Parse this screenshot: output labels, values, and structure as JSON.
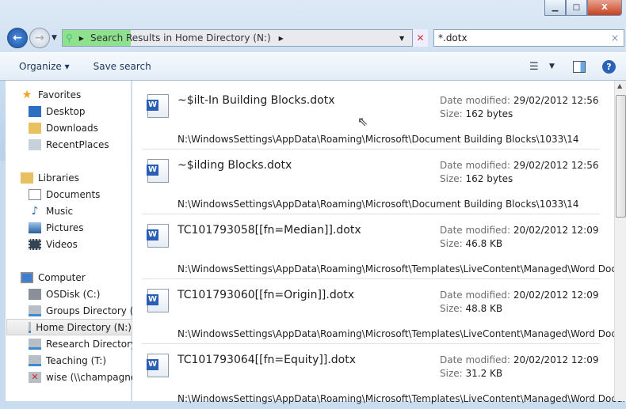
{
  "window": {
    "minimize": "▁",
    "maximize": "□",
    "close": "X"
  },
  "nav": {
    "address_root": "Search Results in Home Directory (N:)",
    "search_value": "*.dotx"
  },
  "toolbar": {
    "organize": "Organize ▾",
    "save_search": "Save search"
  },
  "sidebar": {
    "favorites": {
      "label": "Favorites",
      "items": [
        "Desktop",
        "Downloads",
        "RecentPlaces"
      ]
    },
    "libraries": {
      "label": "Libraries",
      "items": [
        "Documents",
        "Music",
        "Pictures",
        "Videos"
      ]
    },
    "computer": {
      "label": "Computer",
      "items": [
        "OSDisk (C:)",
        "Groups Directory (G:)",
        "Home Directory (N:)",
        "Research Directory (",
        "Teaching (T:)",
        "wise (\\\\champagne."
      ],
      "selected": "Home Directory (N:)"
    }
  },
  "results": {
    "date_label": "Date modified:",
    "size_label": "Size:",
    "items": [
      {
        "name": "~$ilt-In Building Blocks.dotx",
        "date": "29/02/2012 12:56",
        "size": "162 bytes",
        "path": "N:\\WindowsSettings\\AppData\\Roaming\\Microsoft\\Document Building Blocks\\1033\\14"
      },
      {
        "name": "~$ilding Blocks.dotx",
        "date": "29/02/2012 12:56",
        "size": "162 bytes",
        "path": "N:\\WindowsSettings\\AppData\\Roaming\\Microsoft\\Document Building Blocks\\1033\\14"
      },
      {
        "name": "TC101793058[[fn=Median]].dotx",
        "date": "20/02/2012 12:09",
        "size": "46.8 KB",
        "path": "N:\\WindowsSettings\\AppData\\Roaming\\Microsoft\\Templates\\LiveContent\\Managed\\Word Docum..."
      },
      {
        "name": "TC101793060[[fn=Origin]].dotx",
        "date": "20/02/2012 12:09",
        "size": "48.8 KB",
        "path": "N:\\WindowsSettings\\AppData\\Roaming\\Microsoft\\Templates\\LiveContent\\Managed\\Word Docum..."
      },
      {
        "name": "TC101793064[[fn=Equity]].dotx",
        "date": "20/02/2012 12:09",
        "size": "31.2 KB",
        "path": "N:\\WindowsSettings\\AppData\\Roaming\\Microsoft\\Templates\\LiveContent\\Managed\\Word Docum..."
      }
    ]
  }
}
